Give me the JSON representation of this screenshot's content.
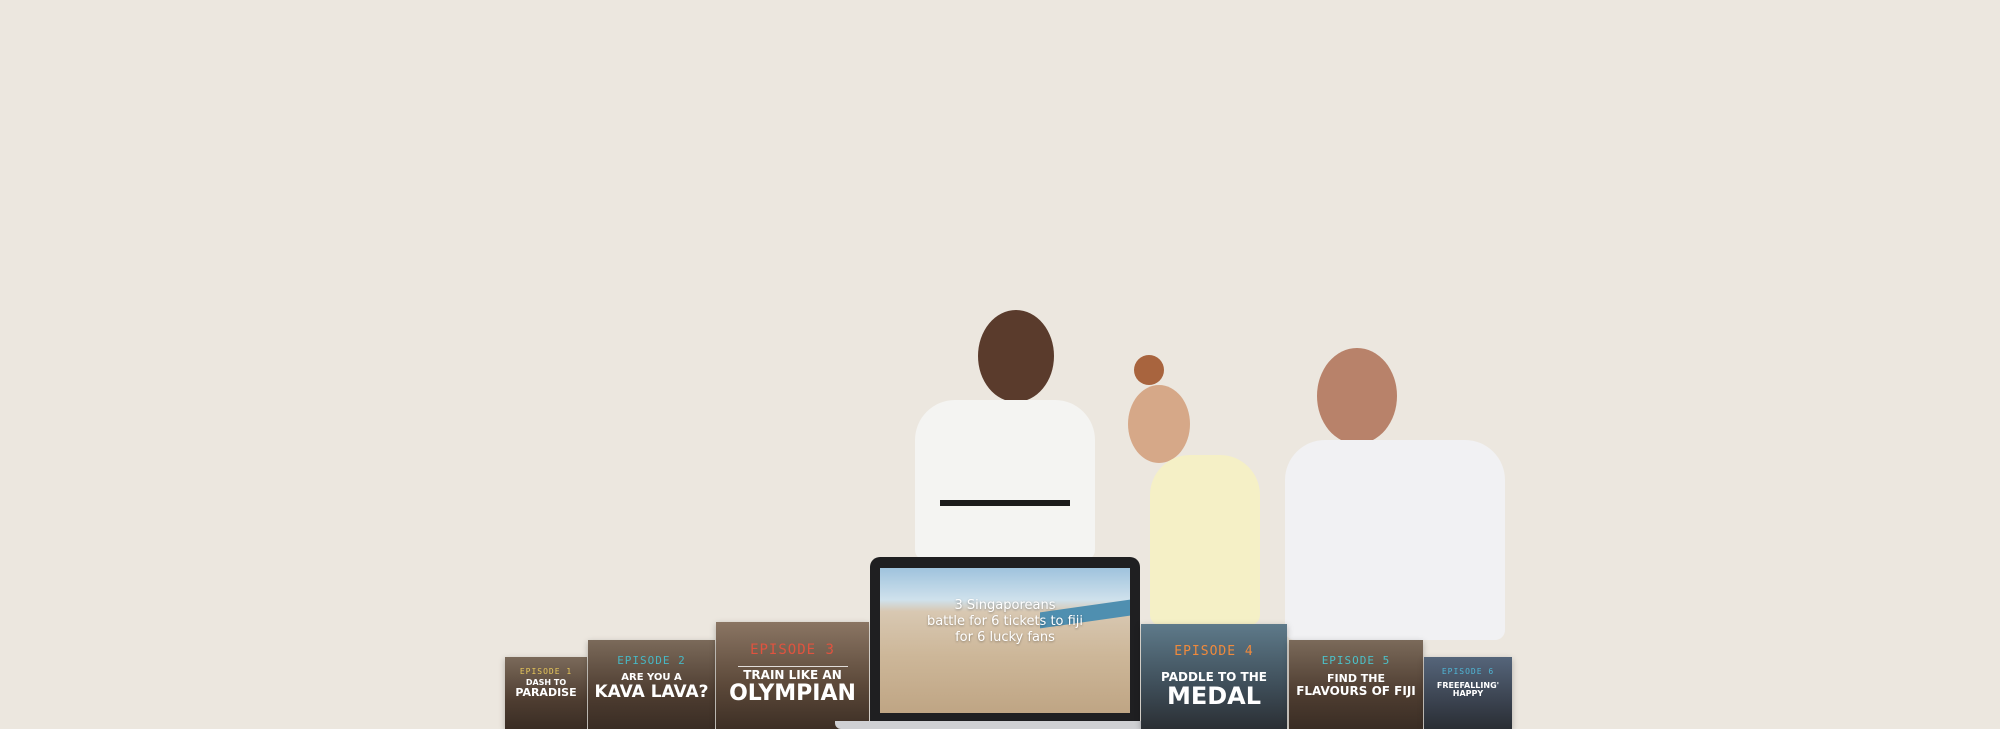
{
  "laptop": {
    "screen_text_line1": "3 Singaporeans",
    "screen_text_line2": "battle for 6 tickets to fiji",
    "screen_text_line3": "for 6 lucky fans"
  },
  "episodes": [
    {
      "label": "EPISODE 1",
      "title_line1": "DASH TO",
      "title_line2": "PARADISE",
      "accent": "#e8c85a"
    },
    {
      "label": "EPISODE 2",
      "title_line1": "ARE YOU A",
      "title_line2": "KAVA LAVA?",
      "accent": "#47b7c4"
    },
    {
      "label": "EPISODE 3",
      "title_line1": "TRAIN LIKE AN",
      "title_line2": "OLYMPIAN",
      "accent": "#e0533f"
    },
    {
      "label": "EPISODE 4",
      "title_line1": "PADDLE TO THE",
      "title_line2": "MEDAL",
      "accent": "#f08a3c"
    },
    {
      "label": "EPISODE 5",
      "title_line1": "FIND THE",
      "title_line2": "FLAVOURS OF FIJI",
      "accent": "#4cc0c8"
    },
    {
      "label": "EPISODE 6",
      "title_line1": "FREEFALLING'",
      "title_line2": "HAPPY",
      "accent": "#4fb6d6"
    }
  ]
}
